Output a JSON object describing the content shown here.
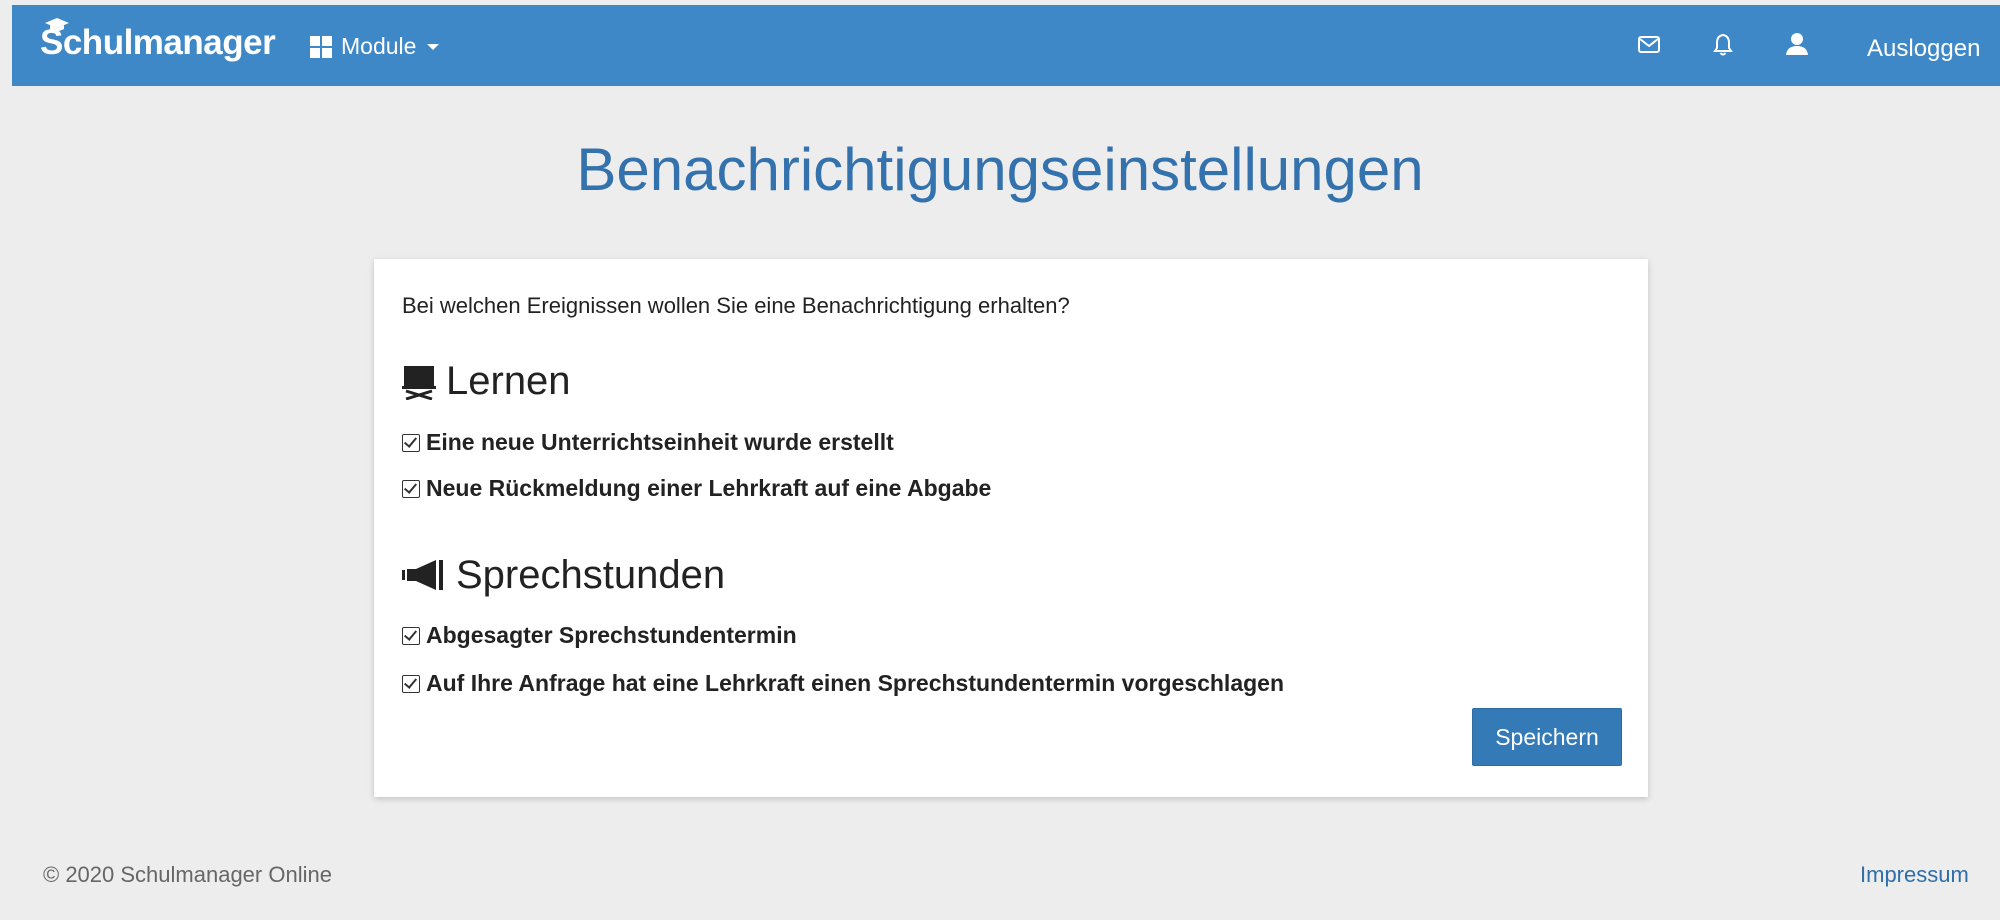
{
  "header": {
    "brand": "Schulmanager",
    "modules_label": "Module",
    "logout_label": "Ausloggen",
    "icons": [
      "mail-icon",
      "bell-icon",
      "user-icon"
    ]
  },
  "page": {
    "title": "Benachrichtigungseinstellungen"
  },
  "card": {
    "question": "Bei welchen Ereignissen wollen Sie eine Benachrichtigung erhalten?",
    "sections": [
      {
        "icon": "blackboard-icon",
        "title": "Lernen",
        "options": [
          {
            "label": "Eine neue Unterrichtseinheit wurde erstellt",
            "checked": true
          },
          {
            "label": "Neue Rückmeldung einer Lehrkraft auf eine Abgabe",
            "checked": true
          }
        ]
      },
      {
        "icon": "megaphone-icon",
        "title": "Sprechstunden",
        "options": [
          {
            "label": "Abgesagter Sprechstundentermin",
            "checked": true
          },
          {
            "label": "Auf Ihre Anfrage hat eine Lehrkraft einen Sprechstundentermin vorgeschlagen",
            "checked": true
          }
        ]
      }
    ],
    "save_label": "Speichern"
  },
  "footer": {
    "copyright": "© 2020 Schulmanager Online",
    "impressum": "Impressum"
  },
  "colors": {
    "navbar": "#3f88c8",
    "title": "#3372ad",
    "button": "#337ab7",
    "background": "#ededed"
  }
}
